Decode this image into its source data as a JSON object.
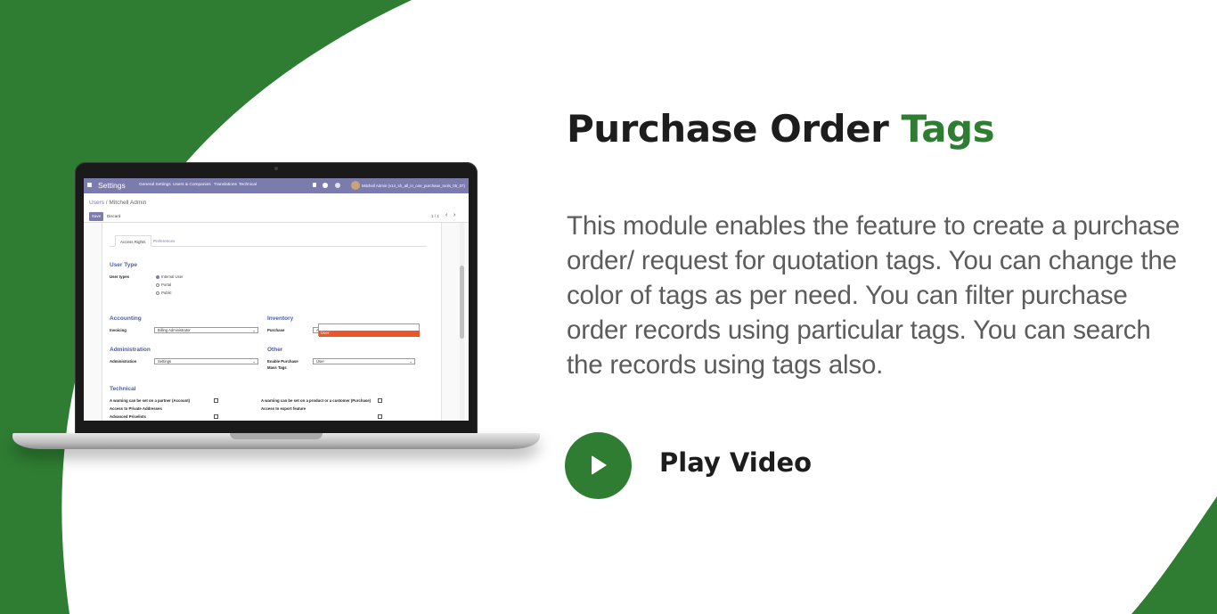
{
  "colors": {
    "accent": "#2e7d32",
    "odoo_purple": "#7c7bad",
    "selected_option": "#e9572b"
  },
  "headline": {
    "main": "Purchase Order",
    "accent": "Tags"
  },
  "description": "This module enables the feature to create a purchase order/ request for quotation tags. You can change the color of tags as per need. You can filter purchase order records using particular tags. You can search the records using tags also.",
  "play": {
    "label": "Play Video",
    "icon": "play-icon"
  },
  "odoo": {
    "navbar": {
      "app": "Settings",
      "menus": [
        "General Settings",
        "Users & Companies",
        "Translations",
        "Technical"
      ],
      "user": "Mitchell Admin (v14_sh_all_in_one_purchase_tools_05_07)"
    },
    "breadcrumb": {
      "parent": "Users",
      "current": "Mitchell Admin"
    },
    "buttons": {
      "save": "Save",
      "discard": "Discard"
    },
    "pager": "1 / 1",
    "tabs": [
      "Access Rights",
      "Preferences"
    ],
    "user_type": {
      "title": "User Type",
      "label": "User types",
      "options": [
        "Internal User",
        "Portal",
        "Public"
      ],
      "selected": "Internal User"
    },
    "accounting": {
      "title": "Accounting",
      "label": "Invoicing",
      "value": "Billing Administrator"
    },
    "inventory": {
      "title": "Inventory",
      "label": "Purchase",
      "value": "Administrator"
    },
    "administration": {
      "title": "Administration",
      "label": "Administration",
      "value": "Settings"
    },
    "other": {
      "title": "Other",
      "enable_label": "Enable Purchase",
      "enable_value": "User",
      "mass_label": "Mass Tags",
      "dropdown_option": "User"
    },
    "technical": {
      "title": "Technical",
      "rows": [
        "A warning can be set on a partner (Account)",
        "A warning can be set on a product or a customer (Purchase)",
        "Access to Private Addresses",
        "Access to export feature",
        "Advanced Pricelists"
      ]
    }
  }
}
